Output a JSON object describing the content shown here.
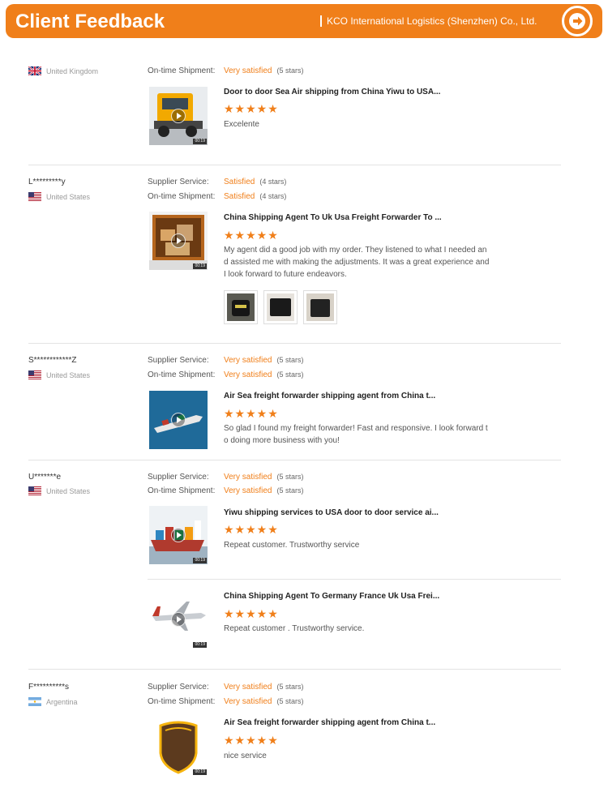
{
  "header": {
    "title": "Client Feedback",
    "company": "KCO International Logistics (Shenzhen) Co., Ltd.",
    "accent": "#f07f1a"
  },
  "reviews": [
    {
      "user": "",
      "country": "United Kingdom",
      "ratings": [
        {
          "label": "On-time Shipment:",
          "value": "Very satisfied",
          "stars": "(5 stars)"
        }
      ],
      "products": [
        {
          "title": "Door to door Sea Air shipping from China Yiwu to USA...",
          "stars": "★★★★★",
          "comment": "Excelente",
          "image": "truck",
          "duration": "00:19"
        }
      ]
    },
    {
      "user": "L*********y",
      "country": "United States",
      "ratings": [
        {
          "label": "Supplier Service:",
          "value": "Satisfied",
          "stars": "(4 stars)"
        },
        {
          "label": "On-time Shipment:",
          "value": "Satisfied",
          "stars": "(4 stars)"
        }
      ],
      "products": [
        {
          "title": "China Shipping Agent To Uk Usa Freight Forwarder To ...",
          "stars": "★★★★★",
          "comment": "My agent did a good job with my order. They listened to what I needed and assisted me with making the adjustments. It was a great experience and I look forward to future endeavors.",
          "image": "container",
          "duration": "00:19"
        }
      ]
    },
    {
      "user": "S************Z",
      "country": "United States",
      "ratings": [
        {
          "label": "Supplier Service:",
          "value": "Very satisfied",
          "stars": "(5 stars)"
        },
        {
          "label": "On-time Shipment:",
          "value": "Very satisfied",
          "stars": "(5 stars)"
        }
      ],
      "products": [
        {
          "title": "Air Sea freight forwarder shipping agent from China t...",
          "stars": "★★★★★",
          "comment": "So glad I found my freight forwarder! Fast and responsive. I look forward to doing more business with you!",
          "image": "ship-top",
          "duration": ""
        }
      ]
    },
    {
      "user": "U*******e",
      "country": "United States",
      "ratings": [
        {
          "label": "Supplier Service:",
          "value": "Very satisfied",
          "stars": "(5 stars)"
        },
        {
          "label": "On-time Shipment:",
          "value": "Very satisfied",
          "stars": "(5 stars)"
        }
      ],
      "products": [
        {
          "title": "Yiwu shipping services to USA door to door service ai...",
          "stars": "★★★★★",
          "comment": "Repeat customer. Trustworthy service",
          "image": "cargo-ship",
          "duration": "00:19"
        },
        {
          "title": "China Shipping Agent To Germany France Uk Usa Frei...",
          "stars": "★★★★★",
          "comment": "Repeat customer . Trustworthy service.",
          "image": "plane",
          "duration": "00:19"
        }
      ]
    },
    {
      "user": "F**********s",
      "country": "Argentina",
      "ratings": [
        {
          "label": "Supplier Service:",
          "value": "Very satisfied",
          "stars": "(5 stars)"
        },
        {
          "label": "On-time Shipment:",
          "value": "Very satisfied",
          "stars": "(5 stars)"
        }
      ],
      "products": [
        {
          "title": "Air Sea freight forwarder shipping agent from China t...",
          "stars": "★★★★★",
          "comment": "nice service",
          "image": "ups",
          "duration": "00:19"
        }
      ]
    }
  ]
}
